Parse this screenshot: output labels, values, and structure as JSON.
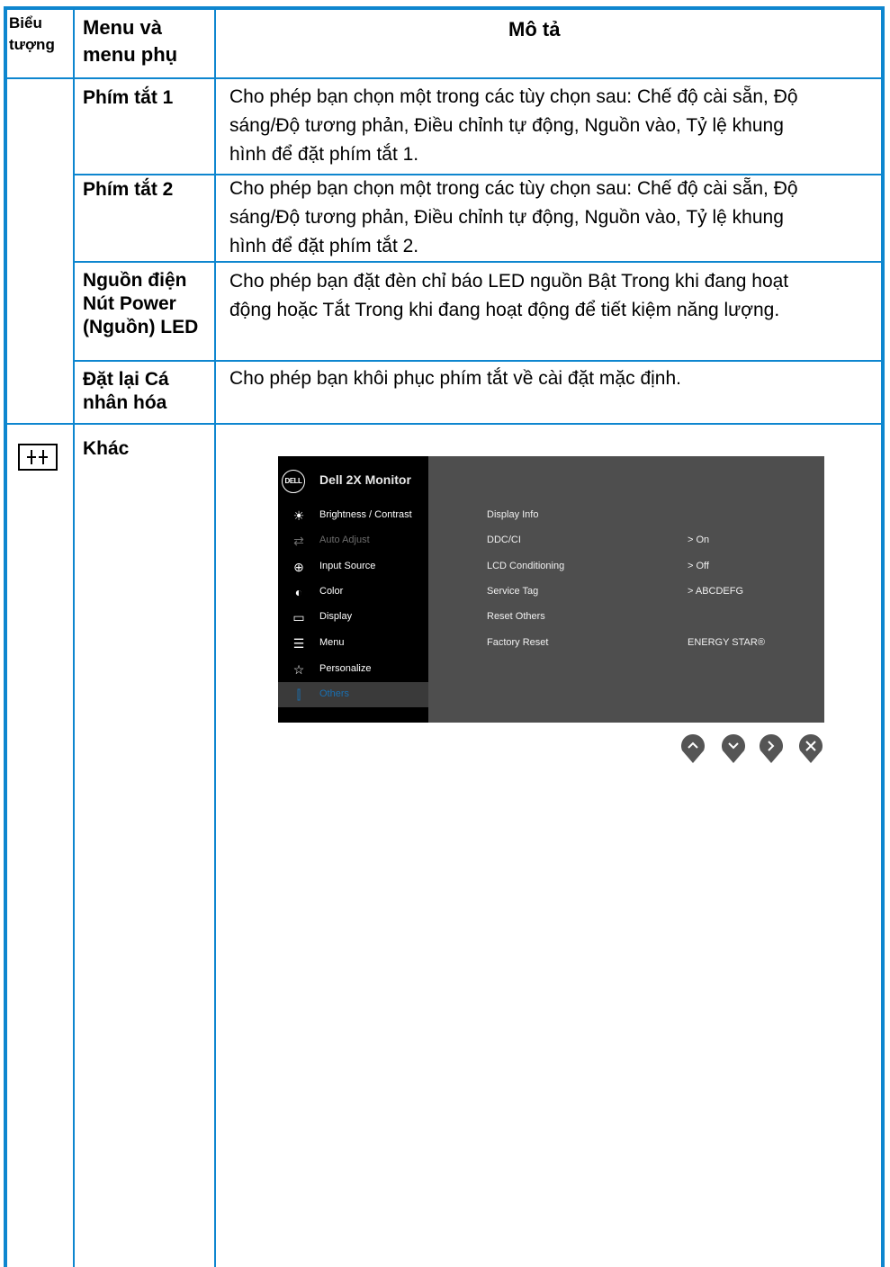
{
  "header": {
    "col_icon": [
      "Biểu",
      "tượng"
    ],
    "col_menu": [
      "Menu và",
      "menu phụ"
    ],
    "col_desc": "Mô tả"
  },
  "rows": [
    {
      "menu": [
        "Phím tắt 1"
      ],
      "desc": [
        "Cho phép bạn chọn một trong các tùy chọn sau: Chế độ cài sẵn, Độ",
        "sáng/Độ tương phản, Điều chỉnh tự động, Nguồn vào, Tỷ lệ khung",
        "hình để đặt phím tắt 1."
      ]
    },
    {
      "menu": [
        "Phím tắt 2"
      ],
      "desc": [
        "Cho phép bạn chọn một trong các tùy chọn sau: Chế độ cài sẵn, Độ",
        "sáng/Độ tương phản, Điều chỉnh tự động, Nguồn vào, Tỷ lệ khung",
        "hình để đặt phím tắt 2."
      ]
    },
    {
      "menu": [
        "Nguồn điện",
        "Nút Power",
        "(Nguồn) LED"
      ],
      "desc": [
        "Cho phép bạn đặt đèn chỉ báo LED nguồn Bật Trong khi đang hoạt",
        "động hoặc Tắt Trong khi đang hoạt động để tiết kiệm năng lượng."
      ]
    },
    {
      "menu": [
        "Đặt lại Cá",
        "nhân hóa"
      ],
      "desc": [
        "Cho phép bạn khôi phục phím tắt về cài đặt mặc định."
      ]
    },
    {
      "menu": [
        "Khác"
      ],
      "icon": "others-icon"
    }
  ],
  "osd": {
    "logo": "DELL",
    "title": "Dell 2X Monitor",
    "menu_items": [
      {
        "label": "Brightness / Contrast",
        "icon": "brightness-icon",
        "state": "normal"
      },
      {
        "label": "Auto Adjust",
        "icon": "auto-adjust-icon",
        "state": "disabled"
      },
      {
        "label": "Input Source",
        "icon": "input-source-icon",
        "state": "normal"
      },
      {
        "label": "Color",
        "icon": "color-icon",
        "state": "normal"
      },
      {
        "label": "Display",
        "icon": "display-icon",
        "state": "normal"
      },
      {
        "label": "Menu",
        "icon": "menu-icon",
        "state": "normal"
      },
      {
        "label": "Personalize",
        "icon": "personalize-icon",
        "state": "normal"
      },
      {
        "label": "Others",
        "icon": "others-icon",
        "state": "active"
      }
    ],
    "sub_items": [
      {
        "label": "Display Info",
        "value": ""
      },
      {
        "label": "DDC/CI",
        "value": ">   On"
      },
      {
        "label": "LCD Conditioning",
        "value": ">   Off"
      },
      {
        "label": "Service Tag",
        "value": ">   ABCDEFG"
      },
      {
        "label": "Reset Others",
        "value": ""
      },
      {
        "label": "Factory Reset",
        "value": "ENERGY STAR®"
      }
    ],
    "buttons": [
      "up-button",
      "down-button",
      "right-button",
      "close-button"
    ]
  },
  "colors": {
    "border": "#0e86cf",
    "osd_bg": "#4e4e4e",
    "osd_active": "#1a6fb0"
  }
}
